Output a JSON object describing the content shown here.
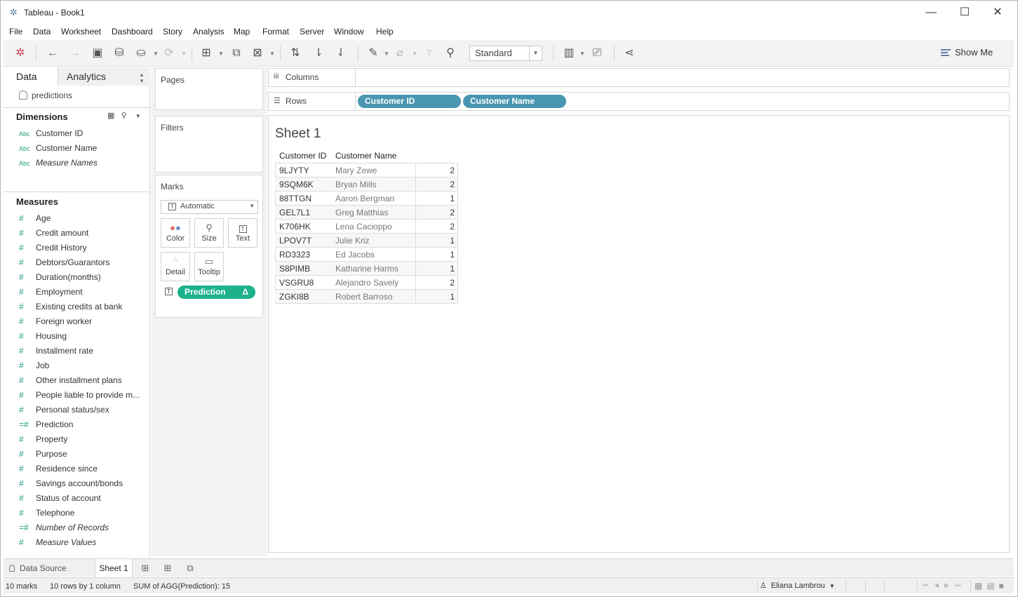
{
  "window": {
    "title": "Tableau - Book1",
    "app_icon": "tableau-logo-icon"
  },
  "menu": [
    "File",
    "Data",
    "Worksheet",
    "Dashboard",
    "Story",
    "Analysis",
    "Map",
    "Format",
    "Server",
    "Window",
    "Help"
  ],
  "toolbar": {
    "fit_select": "Standard",
    "show_me": "Show Me"
  },
  "data_pane": {
    "tab_data": "Data",
    "tab_analytics": "Analytics",
    "datasource": "predictions",
    "dimensions_header": "Dimensions",
    "dimensions": [
      {
        "type": "Abc",
        "label": "Customer ID",
        "italic": false
      },
      {
        "type": "Abc",
        "label": "Customer Name",
        "italic": false
      },
      {
        "type": "Abc",
        "label": "Measure Names",
        "italic": true
      }
    ],
    "measures_header": "Measures",
    "measures": [
      {
        "icon": "#",
        "label": "Age",
        "italic": false
      },
      {
        "icon": "#",
        "label": "Credit amount",
        "italic": false
      },
      {
        "icon": "#",
        "label": "Credit History",
        "italic": false
      },
      {
        "icon": "#",
        "label": "Debtors/Guarantors",
        "italic": false
      },
      {
        "icon": "#",
        "label": "Duration(months)",
        "italic": false
      },
      {
        "icon": "#",
        "label": "Employment",
        "italic": false
      },
      {
        "icon": "#",
        "label": "Existing credits at bank",
        "italic": false
      },
      {
        "icon": "#",
        "label": "Foreign worker",
        "italic": false
      },
      {
        "icon": "#",
        "label": "Housing",
        "italic": false
      },
      {
        "icon": "#",
        "label": "Installment rate",
        "italic": false
      },
      {
        "icon": "#",
        "label": "Job",
        "italic": false
      },
      {
        "icon": "#",
        "label": "Other installment plans",
        "italic": false
      },
      {
        "icon": "#",
        "label": "People liable to provide m...",
        "italic": false
      },
      {
        "icon": "#",
        "label": "Personal status/sex",
        "italic": false
      },
      {
        "icon": "=#",
        "label": "Prediction",
        "italic": false
      },
      {
        "icon": "#",
        "label": "Property",
        "italic": false
      },
      {
        "icon": "#",
        "label": "Purpose",
        "italic": false
      },
      {
        "icon": "#",
        "label": "Residence since",
        "italic": false
      },
      {
        "icon": "#",
        "label": "Savings account/bonds",
        "italic": false
      },
      {
        "icon": "#",
        "label": "Status of account",
        "italic": false
      },
      {
        "icon": "#",
        "label": "Telephone",
        "italic": false
      },
      {
        "icon": "=#",
        "label": "Number of Records",
        "italic": true
      },
      {
        "icon": "#",
        "label": "Measure Values",
        "italic": true
      }
    ]
  },
  "cards": {
    "pages": "Pages",
    "filters": "Filters",
    "marks": "Marks",
    "mark_type": "Automatic",
    "buttons": [
      "Color",
      "Size",
      "Text",
      "Detail",
      "Tooltip"
    ],
    "mark_pill": "Prediction",
    "mark_pill_badge": "Δ"
  },
  "shelves": {
    "columns_label": "Columns",
    "rows_label": "Rows",
    "rows_pills": [
      "Customer ID",
      "Customer Name"
    ]
  },
  "sheet": {
    "title": "Sheet 1",
    "headers": [
      "Customer ID",
      "Customer Name"
    ],
    "rows": [
      {
        "id": "9LJYTY",
        "name": "Mary Zewe",
        "value": "2"
      },
      {
        "id": "9SQM6K",
        "name": "Bryan Mills",
        "value": "2"
      },
      {
        "id": "88TTGN",
        "name": "Aaron Bergman",
        "value": "1"
      },
      {
        "id": "GEL7L1",
        "name": "Greg Matthias",
        "value": "2"
      },
      {
        "id": "K706HK",
        "name": "Lena Cacioppo",
        "value": "2"
      },
      {
        "id": "LPOV7T",
        "name": "Julie Kriz",
        "value": "1"
      },
      {
        "id": "RD3323",
        "name": "Ed Jacobs",
        "value": "1"
      },
      {
        "id": "S8PIMB",
        "name": "Katharine Harms",
        "value": "1"
      },
      {
        "id": "VSGRU8",
        "name": "Alejandro Savely",
        "value": "2"
      },
      {
        "id": "ZGKI8B",
        "name": "Robert Barroso",
        "value": "1"
      }
    ]
  },
  "tabs": {
    "data_source": "Data Source",
    "sheet1": "Sheet 1"
  },
  "status": {
    "marks": "10 marks",
    "rows_cols": "10 rows by 1 column",
    "sum": "SUM of AGG(Prediction): 15",
    "user": "Eliana Lambrou"
  },
  "colors": {
    "pill_green": "#1bb28c",
    "pill_blue": "#4996b2",
    "field_icon": "#1e9a84"
  }
}
